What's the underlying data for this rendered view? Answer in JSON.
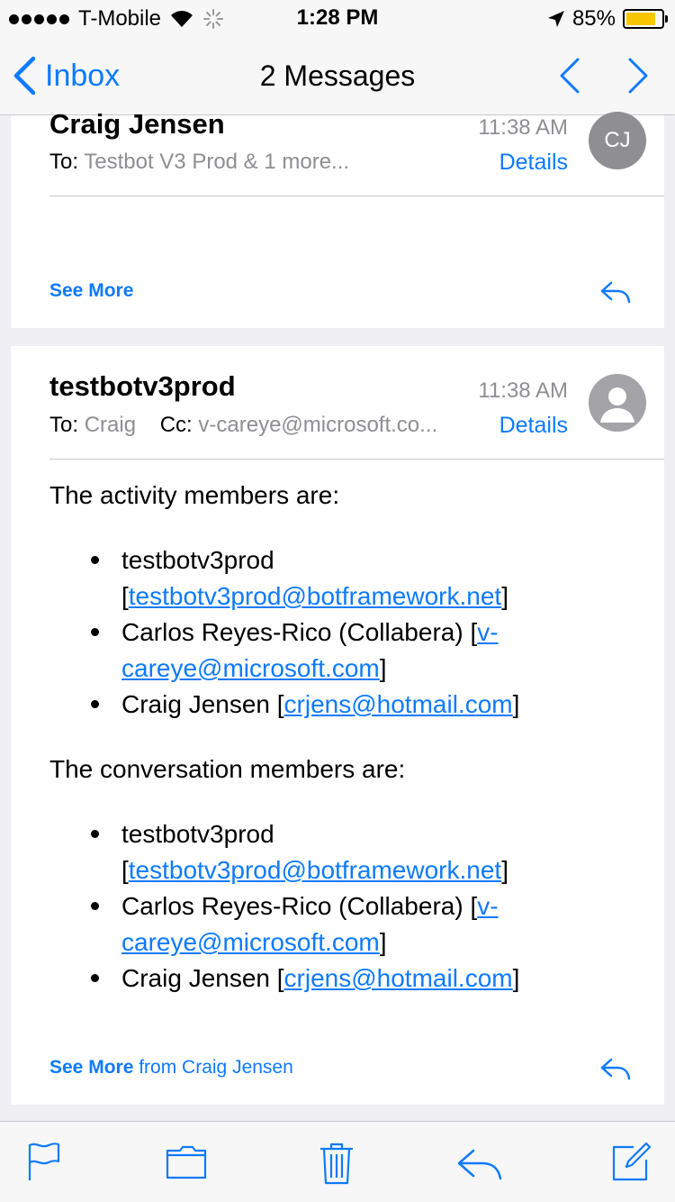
{
  "status": {
    "carrier": "T-Mobile",
    "time": "1:28 PM",
    "battery": "85%",
    "battery_level": 0.85
  },
  "nav": {
    "back_label": "Inbox",
    "title": "2 Messages"
  },
  "message1": {
    "sender": "Craig Jensen",
    "time": "11:38 AM",
    "avatar": "CJ",
    "to_label": "To:",
    "to_value": "Testbot V3 Prod & 1 more...",
    "details": "Details",
    "see_more": "See More"
  },
  "message2": {
    "sender": "testbotv3prod",
    "time": "11:38 AM",
    "to_label": "To:",
    "to_value": "Craig",
    "cc_label": "Cc:",
    "cc_value": "v-careye@microsoft.co...",
    "details": "Details",
    "activity_heading": "The activity members are:",
    "activity_members": [
      {
        "name": "testbotv3prod",
        "open": "[",
        "email": "testbotv3prod@botframework.net",
        "close": "]"
      },
      {
        "name": "Carlos Reyes-Rico (Collabera)",
        "open": "[",
        "email": "v-careye@microsoft.com",
        "close": "]"
      },
      {
        "name": "Craig Jensen",
        "open": "[",
        "email": "crjens@hotmail.com",
        "close": "]"
      }
    ],
    "conversation_heading": "The conversation members are:",
    "conversation_members": [
      {
        "name": "testbotv3prod",
        "open": "[",
        "email": "testbotv3prod@botframework.net",
        "close": "]"
      },
      {
        "name": "Carlos Reyes-Rico (Collabera)",
        "open": "[",
        "email": "v-careye@microsoft.com",
        "close": "]"
      },
      {
        "name": "Craig Jensen",
        "open": "[",
        "email": "crjens@hotmail.com",
        "close": "]"
      }
    ],
    "see_more": "See More",
    "see_more_from": "from Craig Jensen"
  },
  "icons": {
    "flag": "flag-icon",
    "folder": "folder-icon",
    "trash": "trash-icon",
    "reply": "reply-icon",
    "compose": "compose-icon"
  },
  "colors": {
    "accent": "#0e7aff",
    "battery": "#f7c600",
    "secondary_text": "#8e8e93"
  }
}
